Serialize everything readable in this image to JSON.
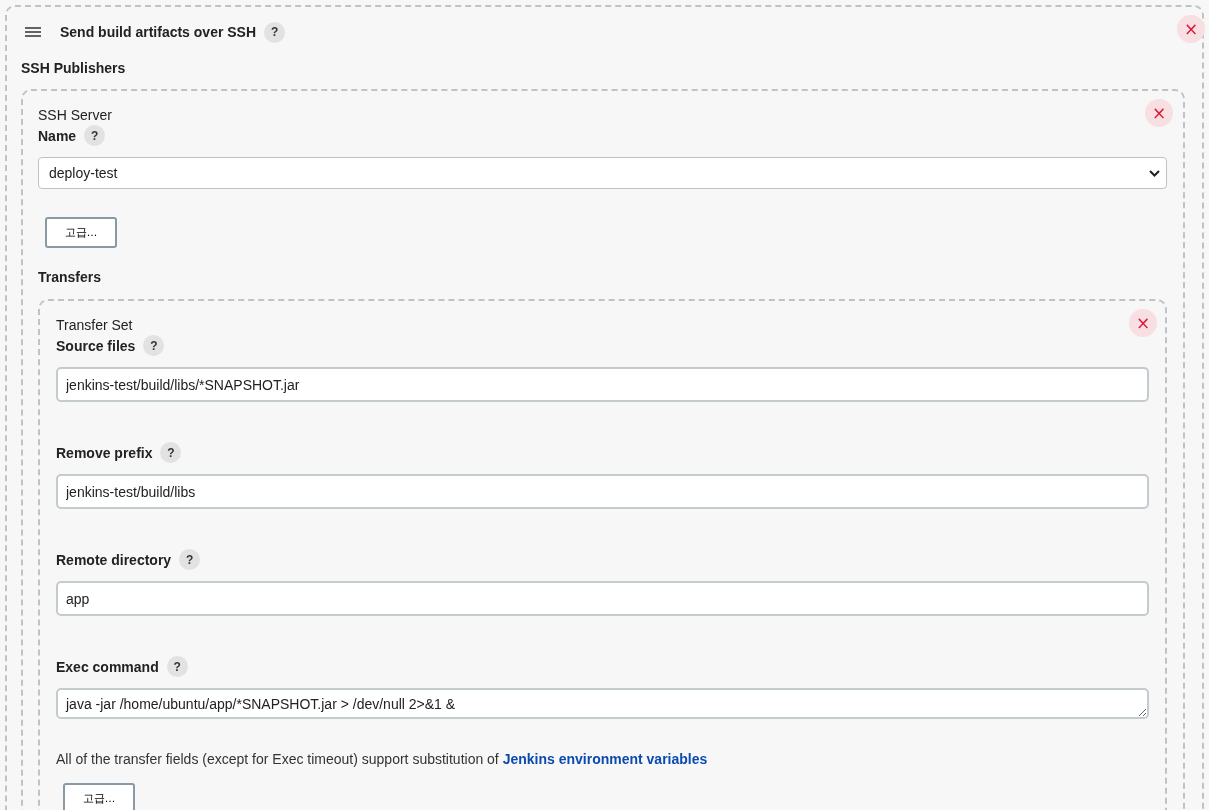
{
  "step": {
    "title": "Send build artifacts over SSH",
    "help": "?",
    "close": "×"
  },
  "publishers_label": "SSH Publishers",
  "server": {
    "heading": "SSH Server",
    "name_label": "Name",
    "name_help": "?",
    "name_value": "deploy-test",
    "close": "×",
    "advanced_button": "고급...",
    "transfers_label": "Transfers",
    "transfer_set": {
      "heading": "Transfer Set",
      "close": "×",
      "fields": [
        {
          "kind": "input",
          "label": "Source files",
          "help": "?",
          "value": "jenkins-test/build/libs/*SNAPSHOT.jar"
        },
        {
          "kind": "input",
          "label": "Remove prefix",
          "help": "?",
          "value": "jenkins-test/build/libs"
        },
        {
          "kind": "input",
          "label": "Remote directory",
          "help": "?",
          "value": "app"
        },
        {
          "kind": "textarea",
          "label": "Exec command",
          "help": "?",
          "value": "java -jar /home/ubuntu/app/*SNAPSHOT.jar > /dev/null 2>&1 &"
        }
      ],
      "note": "All of the transfer fields (except for Exec timeout) support substitution of",
      "note_link": "Jenkins environment variables",
      "advanced_button": "고급..."
    }
  }
}
